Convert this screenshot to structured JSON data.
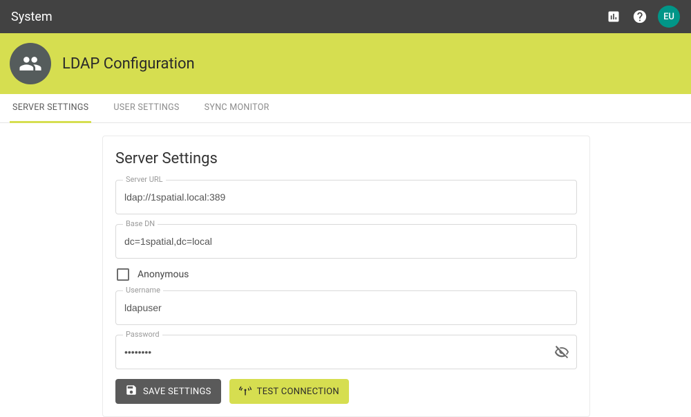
{
  "topbar": {
    "title": "System",
    "avatar": "EU"
  },
  "header": {
    "title": "LDAP Configuration"
  },
  "tabs": [
    {
      "label": "SERVER SETTINGS",
      "active": true
    },
    {
      "label": "USER SETTINGS",
      "active": false
    },
    {
      "label": "SYNC MONITOR",
      "active": false
    }
  ],
  "card": {
    "title": "Server Settings",
    "server_url": {
      "label": "Server URL",
      "value": "ldap://1spatial.local:389"
    },
    "base_dn": {
      "label": "Base DN",
      "value": "dc=1spatial,dc=local"
    },
    "anonymous": {
      "label": "Anonymous",
      "checked": false
    },
    "username": {
      "label": "Username",
      "value": "ldapuser"
    },
    "password": {
      "label": "Password",
      "value": "••••••••"
    },
    "buttons": {
      "save": "SAVE SETTINGS",
      "test": "TEST CONNECTION"
    }
  }
}
